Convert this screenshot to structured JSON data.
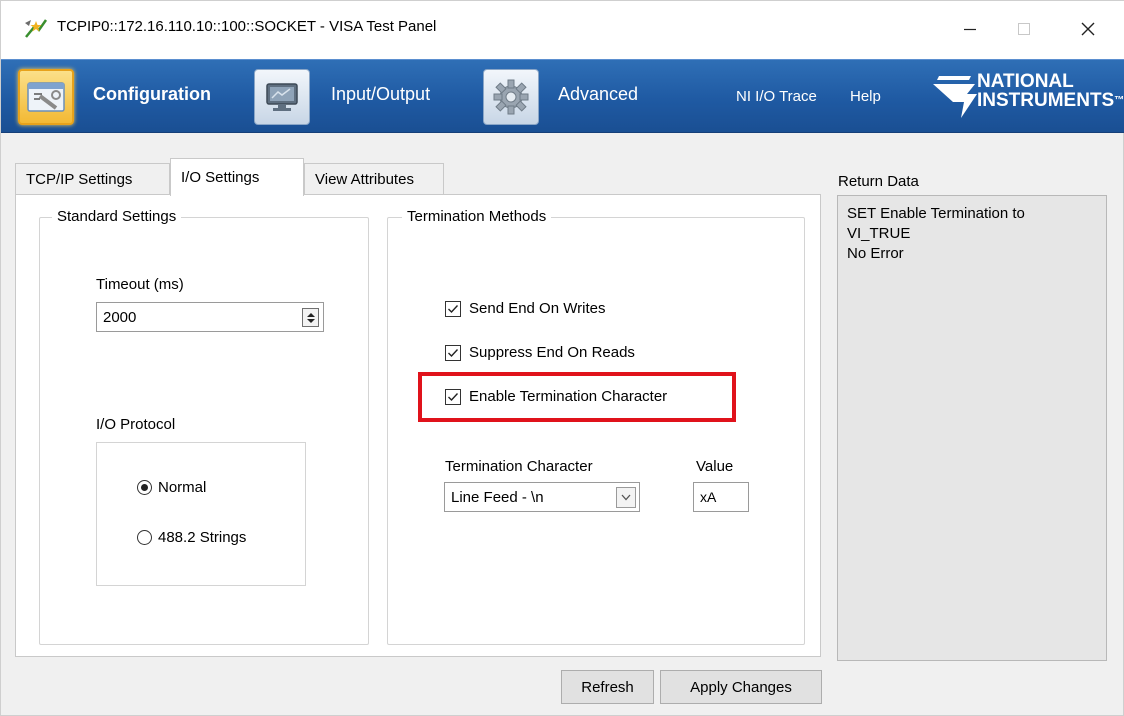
{
  "window": {
    "title": "TCPIP0::172.16.110.10::100::SOCKET - VISA Test Panel",
    "controls": {
      "minimize": "—",
      "maximize": "☐",
      "close": "✕"
    }
  },
  "toolbar": {
    "items": [
      {
        "label": "Configuration",
        "icon": "configuration-icon",
        "selected": true
      },
      {
        "label": "Input/Output",
        "icon": "monitor-icon",
        "selected": false
      },
      {
        "label": "Advanced",
        "icon": "gear-icon",
        "selected": false
      }
    ],
    "links": [
      {
        "label": "NI I/O Trace"
      },
      {
        "label": "Help"
      }
    ],
    "brand": {
      "line1": "NATIONAL",
      "line2": "INSTRUMENTS",
      "suffix": "™"
    },
    "colors": {
      "bar": "#1f5aa3",
      "selected_icon": "#f3b934"
    }
  },
  "tabs": [
    {
      "label": "TCP/IP Settings",
      "active": false
    },
    {
      "label": "I/O Settings",
      "active": true
    },
    {
      "label": "View Attributes",
      "active": false
    }
  ],
  "standard_settings": {
    "title": "Standard Settings",
    "timeout_label": "Timeout (ms)",
    "timeout_value": "2000",
    "protocol_label": "I/O Protocol",
    "protocol_options": [
      {
        "label": "Normal",
        "selected": true
      },
      {
        "label": "488.2 Strings",
        "selected": false
      }
    ]
  },
  "termination": {
    "title": "Termination Methods",
    "checks": [
      {
        "label": "Send End On Writes",
        "checked": true
      },
      {
        "label": "Suppress End On Reads",
        "checked": true
      },
      {
        "label": "Enable Termination Character",
        "checked": true,
        "highlighted": true
      }
    ],
    "char_label": "Termination Character",
    "char_value": "Line Feed - \\n",
    "value_label": "Value",
    "value": "xA",
    "highlight_color": "#e0121b"
  },
  "return_data": {
    "label": "Return Data",
    "lines": [
      "SET Enable Termination to",
      "VI_TRUE",
      "No Error"
    ]
  },
  "buttons": {
    "refresh": "Refresh",
    "apply": "Apply Changes"
  }
}
